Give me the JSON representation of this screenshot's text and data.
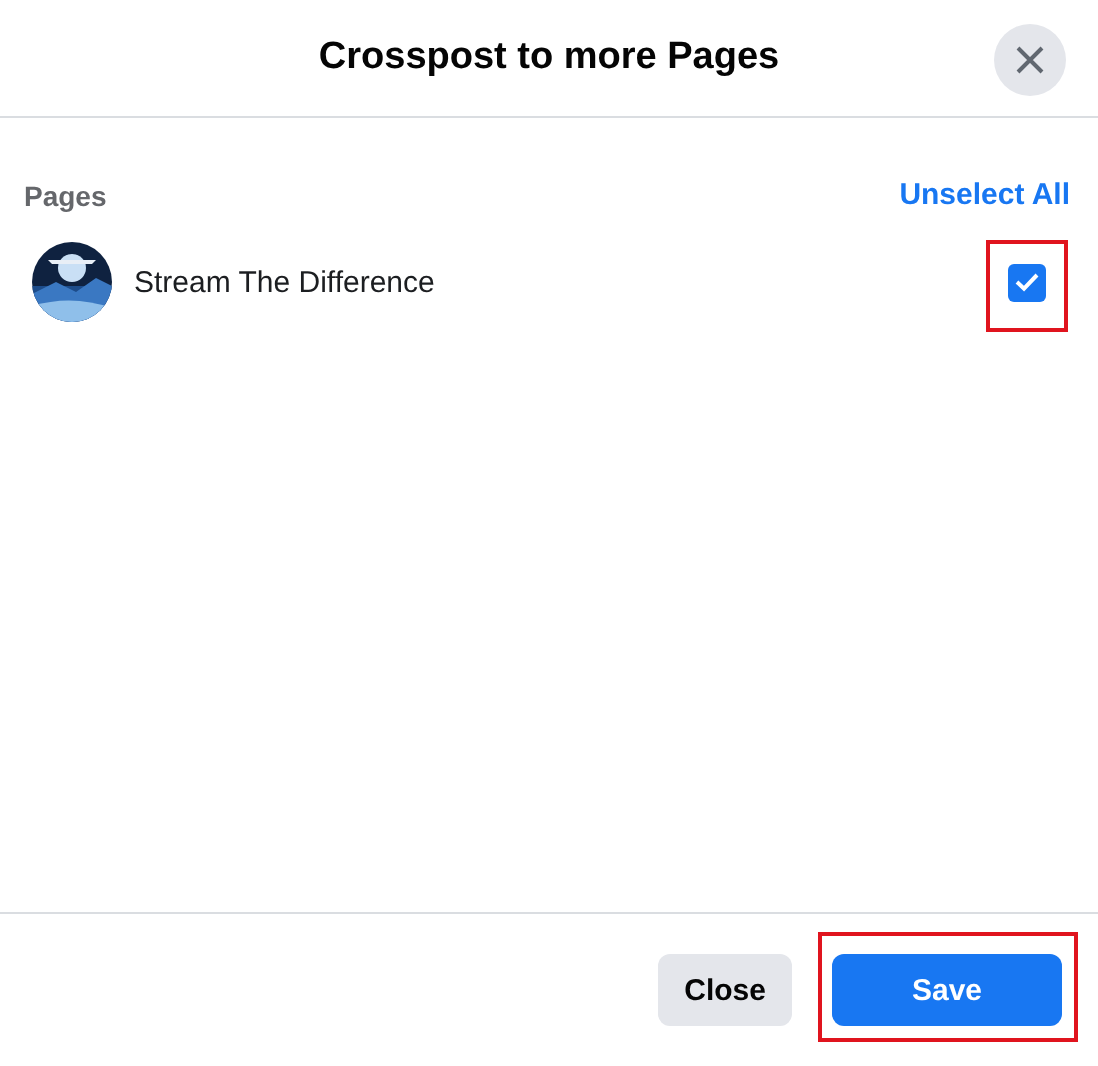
{
  "title": "Crosspost to more Pages",
  "section": {
    "label": "Pages",
    "action": "Unselect All"
  },
  "pages": [
    {
      "name": "Stream The Difference",
      "checked": true,
      "highlighted": true
    }
  ],
  "buttons": [
    {
      "label": "Close",
      "kind": "secondary",
      "highlighted": false
    },
    {
      "label": "Save",
      "kind": "primary",
      "highlighted": true
    }
  ]
}
